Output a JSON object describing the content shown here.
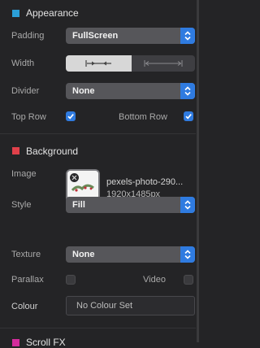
{
  "appearance": {
    "title": "Appearance",
    "accent": "#2b9fd8",
    "padding": {
      "label": "Padding",
      "value": "FullScreen"
    },
    "width": {
      "label": "Width",
      "selected_index": 0
    },
    "divider": {
      "label": "Divider",
      "value": "None"
    },
    "top_row": {
      "label": "Top Row",
      "checked": true
    },
    "bottom_row": {
      "label": "Bottom Row",
      "checked": true
    }
  },
  "background": {
    "title": "Background",
    "accent": "#e0404a",
    "image": {
      "label": "Image",
      "filename": "pexels-photo-290...",
      "dimensions": "1920x1485px"
    },
    "style": {
      "label": "Style",
      "value": "Fill"
    },
    "texture": {
      "label": "Texture",
      "value": "None"
    },
    "parallax": {
      "label": "Parallax",
      "checked": false
    },
    "video": {
      "label": "Video",
      "checked": false
    },
    "colour": {
      "label": "Colour",
      "value": "No Colour Set"
    }
  },
  "next_section": {
    "title": "Scroll FX",
    "accent": "#d42c9c"
  },
  "colors": {
    "select_arrow": "#2f7be0",
    "checkbox_on": "#2f7be0"
  }
}
